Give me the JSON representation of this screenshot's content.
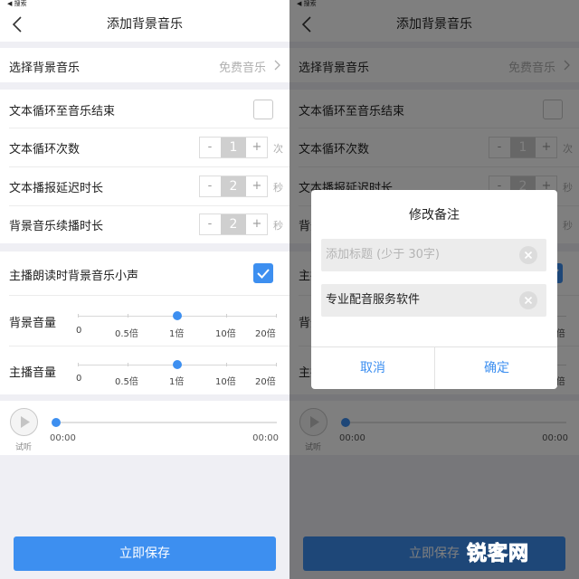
{
  "status_bar": {
    "back_label": "◀ 搜索"
  },
  "nav": {
    "title": "添加背景音乐"
  },
  "bg_music": {
    "label": "选择背景音乐",
    "value": "免费音乐"
  },
  "loop_to_end": {
    "label": "文本循环至音乐结束",
    "checked": false
  },
  "loop_count": {
    "label": "文本循环次数",
    "value": "1",
    "unit": "次",
    "minus": "-",
    "plus": "+"
  },
  "play_delay": {
    "label": "文本播报延迟时长",
    "value": "2",
    "unit": "秒",
    "minus": "-",
    "plus": "+"
  },
  "continue_play": {
    "label": "背景音乐续播时长",
    "value": "2",
    "unit": "秒",
    "minus": "-",
    "plus": "+"
  },
  "duck_music": {
    "label": "主播朗读时背景音乐小声",
    "checked": true
  },
  "bg_volume": {
    "label": "背景音量",
    "level": "1倍"
  },
  "anchor_volume": {
    "label": "主播音量",
    "level": "1倍"
  },
  "volume_ticks": [
    "0",
    "0.5倍",
    "1倍",
    "10倍",
    "20倍"
  ],
  "player": {
    "play_label": "试听",
    "current_time": "00:00",
    "total_time": "00:00"
  },
  "save_button": "立即保存",
  "dialog": {
    "title": "修改备注",
    "title_placeholder": "添加标题 (少于 30字)",
    "content_value": "专业配音服务软件",
    "cancel": "取消",
    "confirm": "确定"
  },
  "watermark": "锐客网",
  "colors": {
    "accent": "#3d8ff0",
    "watermark": "#f07c10"
  }
}
